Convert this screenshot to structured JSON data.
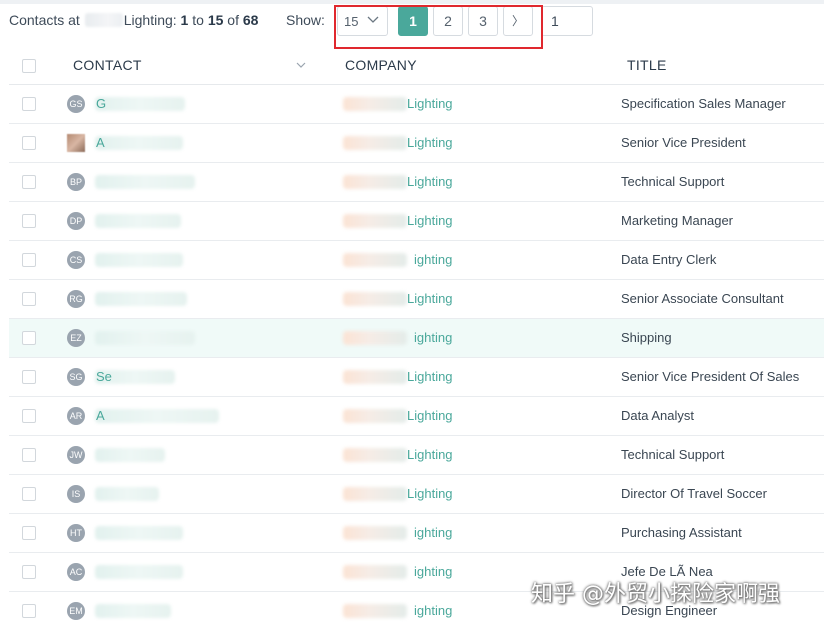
{
  "summary": {
    "prefix": "Contacts at",
    "company_suffix": "Lighting:",
    "from": "1",
    "to_word": "to",
    "to": "15",
    "of_word": "of",
    "total": "68"
  },
  "pagination": {
    "show_label": "Show:",
    "page_size": "15",
    "pages": [
      "1",
      "2",
      "3"
    ],
    "active_page": "1",
    "next_glyph": "〉",
    "jump_value": "1"
  },
  "table": {
    "headers": {
      "contact": "CONTACT",
      "company": "COMPANY",
      "title": "TITLE"
    },
    "company_suffix_full": "Lighting",
    "company_suffix_cut": "ighting",
    "rows": [
      {
        "initials": "GS",
        "initial": "G",
        "company": "Lighting",
        "title": "Specification Sales Manager"
      },
      {
        "initials": "",
        "initial": "A",
        "company": "Lighting",
        "title": "Senior Vice President"
      },
      {
        "initials": "BP",
        "initial": "",
        "company": "Lighting",
        "title": "Technical Support"
      },
      {
        "initials": "DP",
        "initial": "",
        "company": "Lighting",
        "title": "Marketing Manager"
      },
      {
        "initials": "CS",
        "initial": "",
        "company": "ighting",
        "title": "Data Entry Clerk"
      },
      {
        "initials": "RG",
        "initial": "",
        "company": "Lighting",
        "title": "Senior Associate Consultant"
      },
      {
        "initials": "EZ",
        "initial": "",
        "company": "ighting",
        "title": "Shipping"
      },
      {
        "initials": "SG",
        "initial": "Se",
        "company": "Lighting",
        "title": "Senior Vice President Of Sales"
      },
      {
        "initials": "AR",
        "initial": "A",
        "company": "Lighting",
        "title": "Data Analyst"
      },
      {
        "initials": "JW",
        "initial": "",
        "company": "Lighting",
        "title": "Technical Support"
      },
      {
        "initials": "IS",
        "initial": "",
        "company": "Lighting",
        "title": "Director Of Travel Soccer"
      },
      {
        "initials": "HT",
        "initial": "",
        "company": "ighting",
        "title": "Purchasing Assistant"
      },
      {
        "initials": "AC",
        "initial": "",
        "company": "ighting",
        "title": "Jefe De LÃ Nea"
      },
      {
        "initials": "EM",
        "initial": "",
        "company": "ighting",
        "title": "Design Engineer"
      }
    ]
  },
  "watermark": "知乎 @外贸小探险家啊强",
  "colors": {
    "accent": "#4aa89b",
    "highlight_box": "#e0282e",
    "row_hover": "#f0faf8"
  },
  "icons": {
    "page_size_toggle": "chevron-down-icon",
    "contact_sort": "chevron-down-icon"
  }
}
